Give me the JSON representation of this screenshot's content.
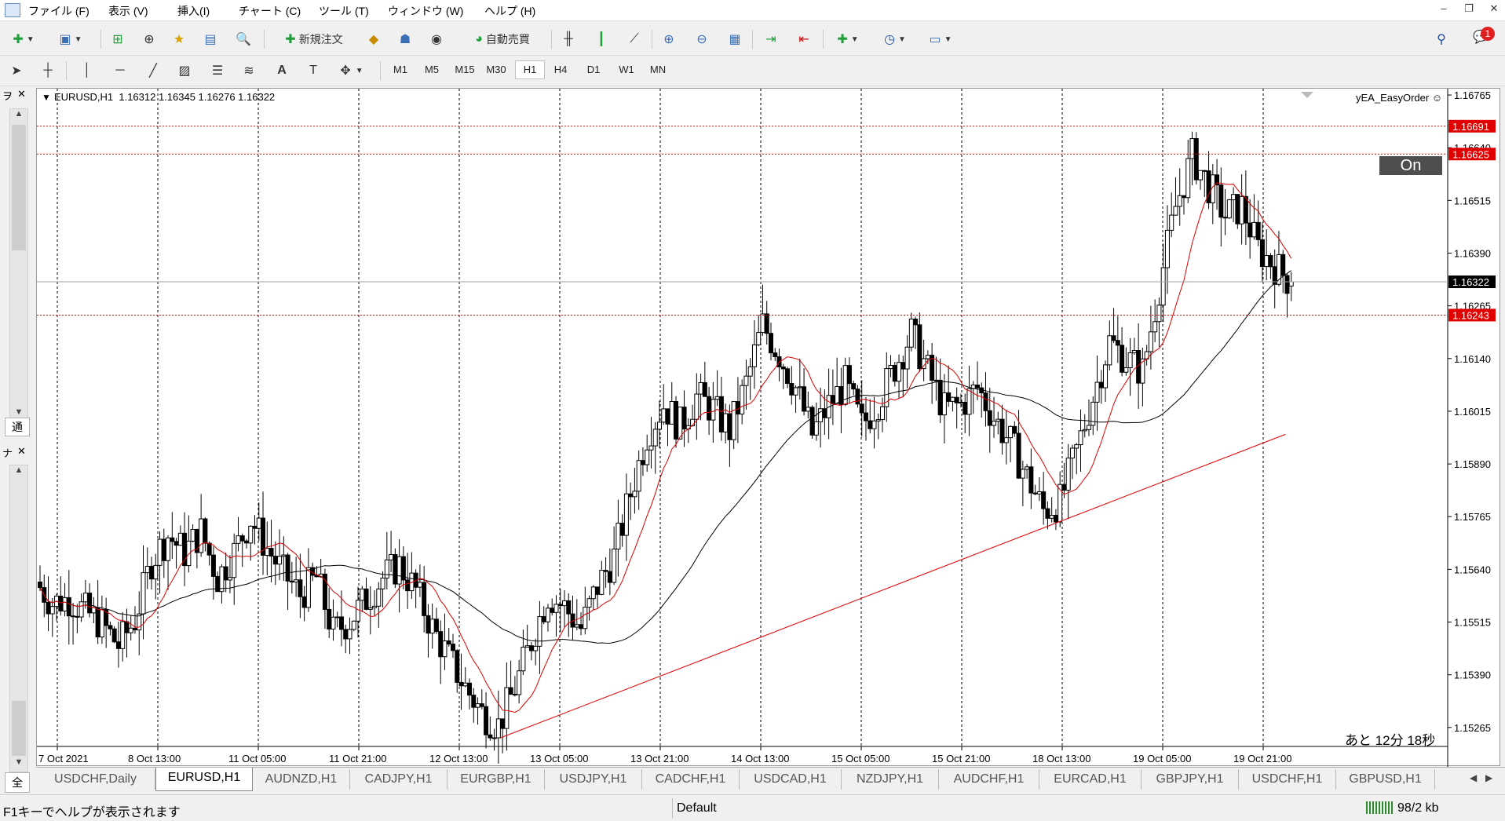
{
  "menubar": {
    "items": [
      "ファイル (F)",
      "表示 (V)",
      "挿入(I)",
      "チャート (C)",
      "ツール (T)",
      "ウィンドウ (W)",
      "ヘルプ (H)"
    ],
    "notification_count": "1"
  },
  "toolbar": {
    "new_order_label": "新規注文",
    "auto_trade_label": "自動売買",
    "timeframes": [
      "M1",
      "M5",
      "M15",
      "M30",
      "H1",
      "H4",
      "D1",
      "W1",
      "MN"
    ],
    "active_timeframe": "H1"
  },
  "left_panel": {
    "tab1": "通",
    "tab2": "全",
    "label_top": "ヲ",
    "label_mid": "ナ"
  },
  "chart": {
    "header": "EURUSD,H1  1.16312 1.16345 1.16276 1.16322",
    "ea_label": "yEA_EasyOrder ☺",
    "on_button": "On",
    "countdown": "あと 12分 18秒",
    "price_levels": [
      "1.16765",
      "1.16640",
      "1.16515",
      "1.16390",
      "1.16265",
      "1.16140",
      "1.16015",
      "1.15890",
      "1.15765",
      "1.15640",
      "1.15515",
      "1.15390",
      "1.15265"
    ],
    "current_price": "1.16322",
    "red_lines": [
      "1.16691",
      "1.16625",
      "1.16243"
    ],
    "time_labels": [
      "7 Oct 2021",
      "8 Oct 13:00",
      "11 Oct 05:00",
      "11 Oct 21:00",
      "12 Oct 13:00",
      "13 Oct 05:00",
      "13 Oct 21:00",
      "14 Oct 13:00",
      "15 Oct 05:00",
      "15 Oct 21:00",
      "18 Oct 13:00",
      "19 Oct 05:00",
      "19 Oct 21:00"
    ],
    "colors": {
      "ma_fast": "#e00000",
      "ma_slow": "#000000",
      "trendline": "#e00000",
      "price_tag": "#e00000"
    }
  },
  "chart_data": {
    "type": "candlestick",
    "symbol": "EURUSD",
    "timeframe": "H1",
    "ohlc_last": {
      "open": 1.16312,
      "high": 1.16345,
      "low": 1.16276,
      "close": 1.16322
    },
    "ylim": [
      1.1522,
      1.1678
    ],
    "close_path": [
      1.1561,
      1.1556,
      1.1557,
      1.1554,
      1.1551,
      1.1546,
      1.1552,
      1.1566,
      1.1572,
      1.1568,
      1.1573,
      1.1562,
      1.1568,
      1.1576,
      1.1569,
      1.1563,
      1.1558,
      1.1562,
      1.1549,
      1.1552,
      1.1557,
      1.1562,
      1.1565,
      1.1559,
      1.155,
      1.1543,
      1.1536,
      1.153,
      1.1527,
      1.1536,
      1.1547,
      1.1558,
      1.1555,
      1.155,
      1.156,
      1.1567,
      1.1582,
      1.1596,
      1.1603,
      1.1598,
      1.1605,
      1.1602,
      1.1597,
      1.1608,
      1.1622,
      1.1615,
      1.1607,
      1.1596,
      1.1603,
      1.1608,
      1.1598,
      1.1604,
      1.1612,
      1.162,
      1.1611,
      1.1602,
      1.1603,
      1.1607,
      1.16,
      1.1594,
      1.1586,
      1.1578,
      1.158,
      1.1592,
      1.1605,
      1.1618,
      1.1614,
      1.1611,
      1.1631,
      1.165,
      1.1662,
      1.1655,
      1.1648,
      1.165,
      1.164,
      1.1636,
      1.1632
    ],
    "indicators": [
      "moving average (red)",
      "moving average (black)"
    ],
    "grid": true
  },
  "tabs": [
    "USDCHF,Daily",
    "EURUSD,H1",
    "AUDNZD,H1",
    "CADJPY,H1",
    "EURGBP,H1",
    "USDJPY,H1",
    "CADCHF,H1",
    "USDCAD,H1",
    "NZDJPY,H1",
    "AUDCHF,H1",
    "EURCAD,H1",
    "GBPJPY,H1",
    "USDCHF,H1",
    "GBPUSD,H1"
  ],
  "active_tab": "EURUSD,H1",
  "statusbar": {
    "help": "F1キーでヘルプが表示されます",
    "profile": "Default",
    "traffic": "98/2 kb"
  }
}
